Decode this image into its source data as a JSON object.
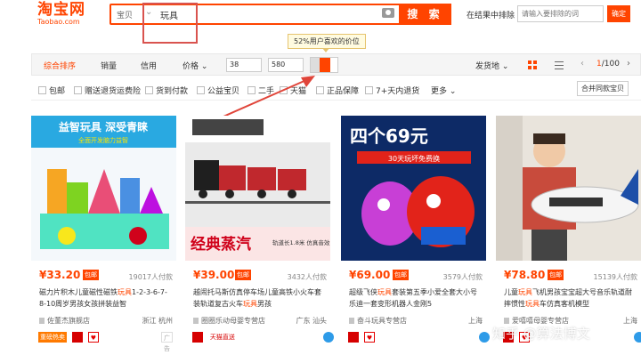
{
  "header": {
    "logo_cn": "淘宝网",
    "logo_en": "Taobao.com",
    "search_scope": "宝贝",
    "search_query": "玩具",
    "search_button": "搜 索",
    "exclude_label": "在结果中排除",
    "exclude_placeholder": "请输入要排除的词",
    "confirm_button": "确定"
  },
  "tooltip": "52%用户喜欢的价位",
  "sortbar": {
    "tabs": [
      "综合排序",
      "销量",
      "信用",
      "价格"
    ],
    "price_low": "38",
    "price_high": "580",
    "price_preference_percent": 52,
    "ship_from": "发货地",
    "page_current": "1",
    "page_total": "/100"
  },
  "filters": {
    "items": [
      "包邮",
      "赠送退货运费险",
      "货到付款",
      "公益宝贝",
      "二手",
      "天猫",
      "正品保障",
      "7+天内退货"
    ],
    "more": "更多",
    "compare_button": "合并同款宝贝"
  },
  "products": [
    {
      "price_symbol": "¥",
      "price": "33.20",
      "baoyou": "包邮",
      "sold": "19017人付款",
      "title_pre": "磁力片积木儿童磁性磁铁",
      "title_hl": "玩具",
      "title_post": "1-2-3-6-7-8-10周岁男孩女孩拼装益智",
      "shop": "佐董杰旗舰店",
      "location": "浙江 杭州",
      "badge": "重磅热卖",
      "badge_grey": "广告",
      "image_text": [
        "益智玩具 深受青睐",
        "全面开发脑力益智"
      ]
    },
    {
      "price_symbol": "¥",
      "price": "39.00",
      "baoyou": "包邮",
      "sold": "3432人付款",
      "title_pre": "越闹托马斯仿真停车场儿童高铁小火车套装轨道复古火车",
      "title_hl": "玩具",
      "title_post": "男孩",
      "shop": "圈圈乐动母婴专营店",
      "location": "广东 汕头",
      "badge": "天猫直送",
      "image_text": [
        "经典蒸汽",
        "轨道长1.8米 仿真音效"
      ]
    },
    {
      "price_symbol": "¥",
      "price": "69.00",
      "baoyou": "包邮",
      "sold": "3579人付款",
      "title_pre": "超级飞侠",
      "title_hl": "玩具",
      "title_post": "套装第五季小爱全套大小号乐迪一套变形机器人金刚5",
      "shop": "奋斗玩具专营店",
      "location": "上海",
      "image_text": [
        "四个69元",
        "30天玩坏免费换"
      ]
    },
    {
      "price_symbol": "¥",
      "price": "78.80",
      "baoyou": "包邮",
      "sold": "15139人付款",
      "title_pre": "儿童",
      "title_hl": "玩具",
      "title_post": "飞机男孩宝宝超大号音乐轨道耐摔惯性",
      "title_hl2": "玩具",
      "title_post2": "车仿真客机模型",
      "shop": "爱嘻嘻母婴专营店",
      "location": "上海"
    }
  ],
  "watermark": "知乎 @算法博文",
  "colors": {
    "accent": "#ff4400",
    "tmall_red": "#d60000"
  }
}
